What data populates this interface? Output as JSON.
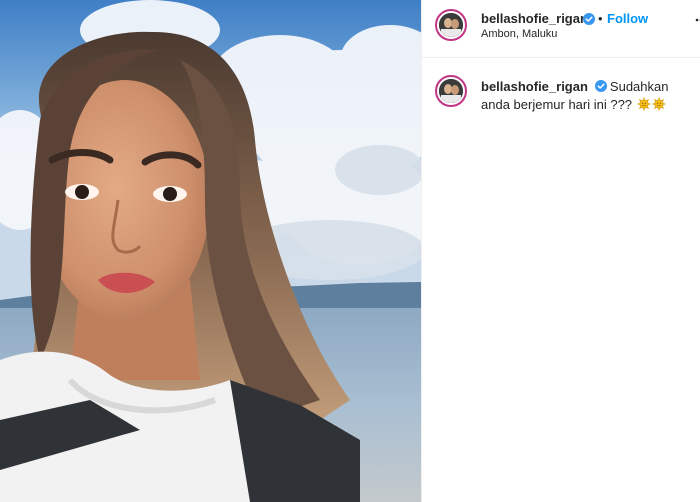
{
  "post": {
    "username": "bellashofie_rigan",
    "location": "Ambon, Maluku",
    "follow_separator": "•",
    "follow_label": "Follow",
    "caption_text": "Sudahkan anda berjemur hari ini ???",
    "caption_emojis": [
      "sun-emoji",
      "sun-emoji"
    ]
  },
  "icons": {
    "verified": "verified-badge-icon",
    "more": "more-options-icon"
  },
  "colors": {
    "link_blue": "#0095f6",
    "verified_blue": "#3897f0",
    "story_ring": "#c13584",
    "sun_yellow": "#f7c21c"
  }
}
